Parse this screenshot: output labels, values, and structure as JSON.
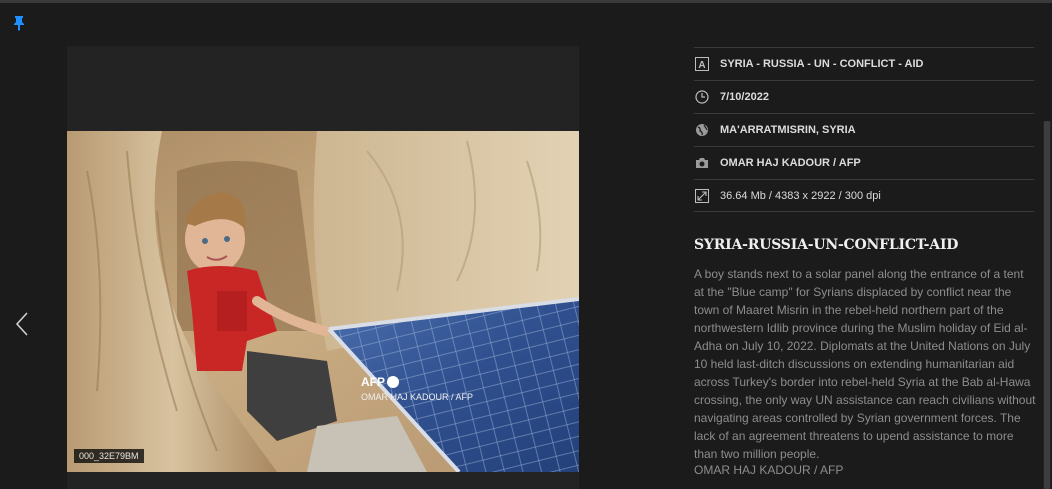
{
  "photo": {
    "id": "000_32E79BM",
    "overlay_logo": "AFP",
    "overlay_credit": "OMAR HAJ KADOUR / AFP"
  },
  "meta": {
    "title": "SYRIA - RUSSIA - UN - CONFLICT - AID",
    "date": "7/10/2022",
    "location": "MA'ARRATMISRIN, SYRIA",
    "photographer": "OMAR HAJ KADOUR / AFP",
    "file_info": "36.64 Mb / 4383 x 2922 / 300 dpi"
  },
  "article": {
    "headline": "SYRIA-RUSSIA-UN-CONFLICT-AID",
    "caption": "A boy stands next to a solar panel along the entrance of a tent at the \"Blue camp\" for Syrians displaced by conflict near the town of Maaret Misrin in the rebel-held northern part of the northwestern Idlib province during the Muslim holiday of Eid al-Adha on July 10, 2022. Diplomats at the United Nations on July 10 held last-ditch discussions on extending humanitarian aid across Turkey's border into rebel-held Syria at the Bab al-Hawa crossing, the only way UN assistance can reach civilians without navigating areas controlled by Syrian government forces. The lack of an agreement threatens to upend assistance to more than two million people.",
    "credit": "OMAR HAJ KADOUR / AFP"
  },
  "icons": {
    "pin": "pin-icon",
    "prev": "chevron-left-icon",
    "title": "letter-a-icon",
    "date": "clock-icon",
    "location": "globe-icon",
    "photographer": "camera-icon",
    "file_info": "expand-icon"
  },
  "colors": {
    "background": "#1b1b1b",
    "pin": "#1e90ff",
    "text": "#dcdcdc",
    "caption": "#8d8d8d"
  }
}
